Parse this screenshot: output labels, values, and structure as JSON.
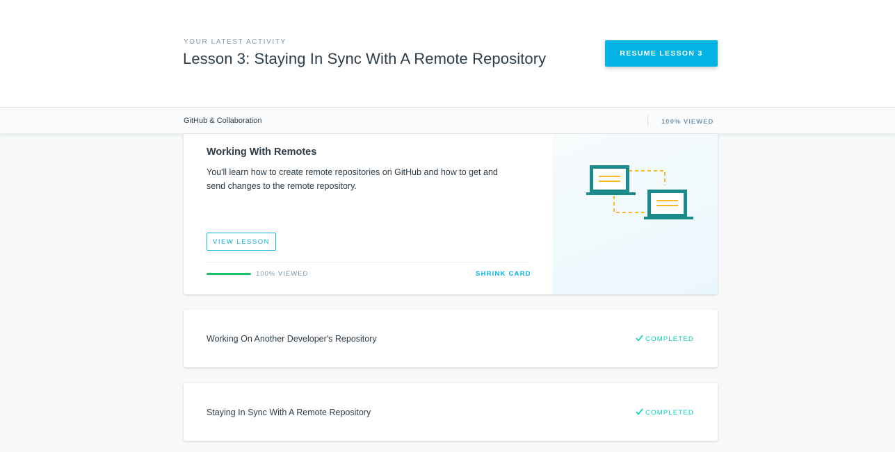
{
  "hero": {
    "eyebrow": "Your Latest Activity",
    "title": "Lesson 3: Staying In Sync With A Remote Repository",
    "resume_label": "Resume Lesson 3"
  },
  "course": {
    "title": "GitHub & Collaboration",
    "progress_label": "100% Viewed",
    "progress_value": 1.0
  },
  "lessons": [
    {
      "title": "Working With Remotes",
      "description": "You'll learn how to create remote repositories on GitHub and how to get and send changes to the remote repository.",
      "view_label": "View Lesson",
      "progress_label": "100% Viewed",
      "progress_value": 1.0,
      "shrink_label": "Shrink Card",
      "illustration_icon": "laptops-sync-icon"
    },
    {
      "title": "Working On Another Developer's Repository",
      "status": "Completed"
    },
    {
      "title": "Staying In Sync With A Remote Repository",
      "status": "Completed"
    }
  ],
  "colors": {
    "accent": "#02b3e4",
    "progress": "#15c26b",
    "completed": "#02ccba",
    "text": "#2e3d49",
    "muted": "#7d97ad",
    "illustration_teal": "#1a8a8a",
    "illustration_orange": "#fdb827"
  }
}
